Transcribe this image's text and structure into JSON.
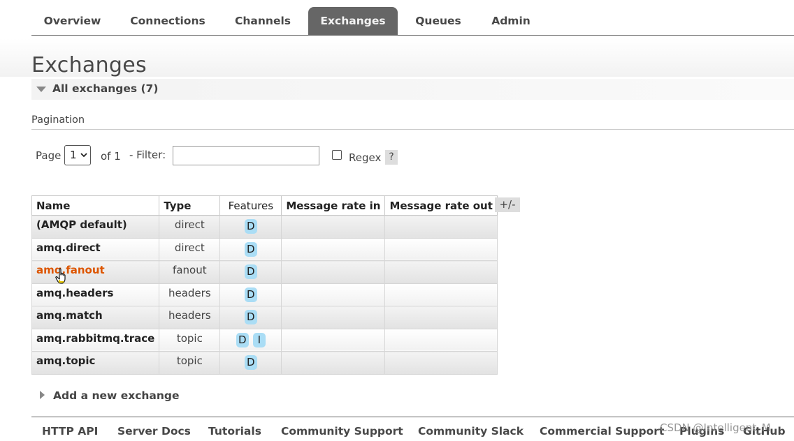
{
  "nav": {
    "tabs": [
      {
        "label": "Overview",
        "active": false
      },
      {
        "label": "Connections",
        "active": false
      },
      {
        "label": "Channels",
        "active": false
      },
      {
        "label": "Exchanges",
        "active": true
      },
      {
        "label": "Queues",
        "active": false
      },
      {
        "label": "Admin",
        "active": false
      }
    ]
  },
  "page": {
    "title": "Exchanges",
    "section_title": "All exchanges (7)"
  },
  "pagination": {
    "label": "Pagination",
    "page_label": "Page",
    "page_value": "1",
    "of_label": "of 1",
    "filter_label": "- Filter:",
    "filter_value": "",
    "regex_label": "Regex",
    "regex_checked": false,
    "help_label": "?"
  },
  "table": {
    "headers": [
      "Name",
      "Type",
      "Features",
      "Message rate in",
      "Message rate out"
    ],
    "columns_toggle": "+/-",
    "rows": [
      {
        "name": "(AMQP default)",
        "type": "direct",
        "features": [
          "D"
        ],
        "rate_in": "",
        "rate_out": ""
      },
      {
        "name": "amq.direct",
        "type": "direct",
        "features": [
          "D"
        ],
        "rate_in": "",
        "rate_out": ""
      },
      {
        "name": "amq.fanout",
        "type": "fanout",
        "features": [
          "D"
        ],
        "rate_in": "",
        "rate_out": "",
        "hovered": true
      },
      {
        "name": "amq.headers",
        "type": "headers",
        "features": [
          "D"
        ],
        "rate_in": "",
        "rate_out": ""
      },
      {
        "name": "amq.match",
        "type": "headers",
        "features": [
          "D"
        ],
        "rate_in": "",
        "rate_out": ""
      },
      {
        "name": "amq.rabbitmq.trace",
        "type": "topic",
        "features": [
          "D",
          "I"
        ],
        "rate_in": "",
        "rate_out": ""
      },
      {
        "name": "amq.topic",
        "type": "topic",
        "features": [
          "D"
        ],
        "rate_in": "",
        "rate_out": ""
      }
    ]
  },
  "add_section": {
    "title": "Add a new exchange"
  },
  "footer": {
    "links": [
      "HTTP API",
      "Server Docs",
      "Tutorials",
      "Community Support",
      "Community Slack",
      "Commercial Support",
      "Plugins",
      "GitHub"
    ]
  },
  "watermark": "CSDN @Intelligent_M",
  "colors": {
    "active_tab": "#666666",
    "link_hover": "#dd5500",
    "feature_badge": "#aaddf5"
  }
}
